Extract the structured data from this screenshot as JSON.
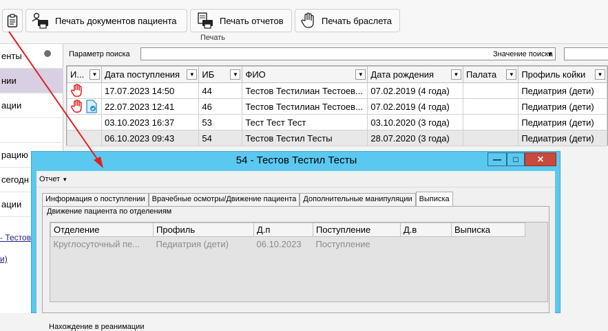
{
  "ribbon": {
    "buttons": [
      {
        "label": ""
      },
      {
        "label": "Печать документов пациента"
      },
      {
        "label": "Печать отчетов"
      },
      {
        "label": "Печать браслета"
      }
    ],
    "group_label": "Печать"
  },
  "sidebar": {
    "items": [
      {
        "label": "енты"
      },
      {
        "label": "нии"
      },
      {
        "label": "ации"
      },
      {
        "label": ""
      },
      {
        "label": "рацию"
      },
      {
        "label": "сегодн"
      },
      {
        "label": "ации"
      }
    ],
    "links": [
      "- Тестов",
      "и)"
    ]
  },
  "search": {
    "param_label": "Параметр поиска",
    "value_label": "Значение поиска"
  },
  "grid": {
    "columns": [
      "И...",
      "Дата поступления",
      "ИБ",
      "ФИО",
      "Дата рождения",
      "Палата",
      "Профиль койки"
    ],
    "rows": [
      {
        "date": "17.07.2023 14:50",
        "ib": "44",
        "fio": "Тестов Тестилиан Тестоев...",
        "birth": "07.02.2019 (4 года)",
        "ward": "",
        "profile": "Педиатрия (дети)"
      },
      {
        "date": "22.07.2023 12:41",
        "ib": "46",
        "fio": "Тестов Тестилиан Тестоев...",
        "birth": "07.02.2019 (4 года)",
        "ward": "",
        "profile": "Педиатрия (дети)"
      },
      {
        "date": "03.10.2023 16:37",
        "ib": "53",
        "fio": "Тест Тест Тест",
        "birth": "03.10.2020 (3 года)",
        "ward": "",
        "profile": "Педиатрия (дети)"
      },
      {
        "date": "06.10.2023 09:43",
        "ib": "54",
        "fio": "Тестов Тестил Тесты",
        "birth": "28.07.2020 (3 года)",
        "ward": "",
        "profile": "Педиатрия (дети)"
      }
    ]
  },
  "modal": {
    "title": "54 - Тестов Тестил Тесты",
    "menu_label": "Отчет",
    "tabs": [
      "Информация о поступлении",
      "Врачебные осмотры/Движение пациента",
      "Дополнительные манипуляции",
      "Выписка"
    ],
    "group_label": "Движение пациента по отделениям",
    "columns": [
      "Отделение",
      "Профиль",
      "Д.п",
      "Поступление",
      "Д.в",
      "Выписка"
    ],
    "rows": [
      {
        "dept": "Круглосуточный пе...",
        "profile": "Педиатрия (дети)",
        "dp": "06.10.2023",
        "admission": "Поступление",
        "dv": "",
        "discharge": ""
      }
    ],
    "reanim_label": "Нахождение в реанимации"
  },
  "colors": {
    "modal_title_bar": "#5bc8ef",
    "close_button": "#c94a3c",
    "arrow": "#e02020",
    "sidebar_active": "#d9cfe3"
  }
}
